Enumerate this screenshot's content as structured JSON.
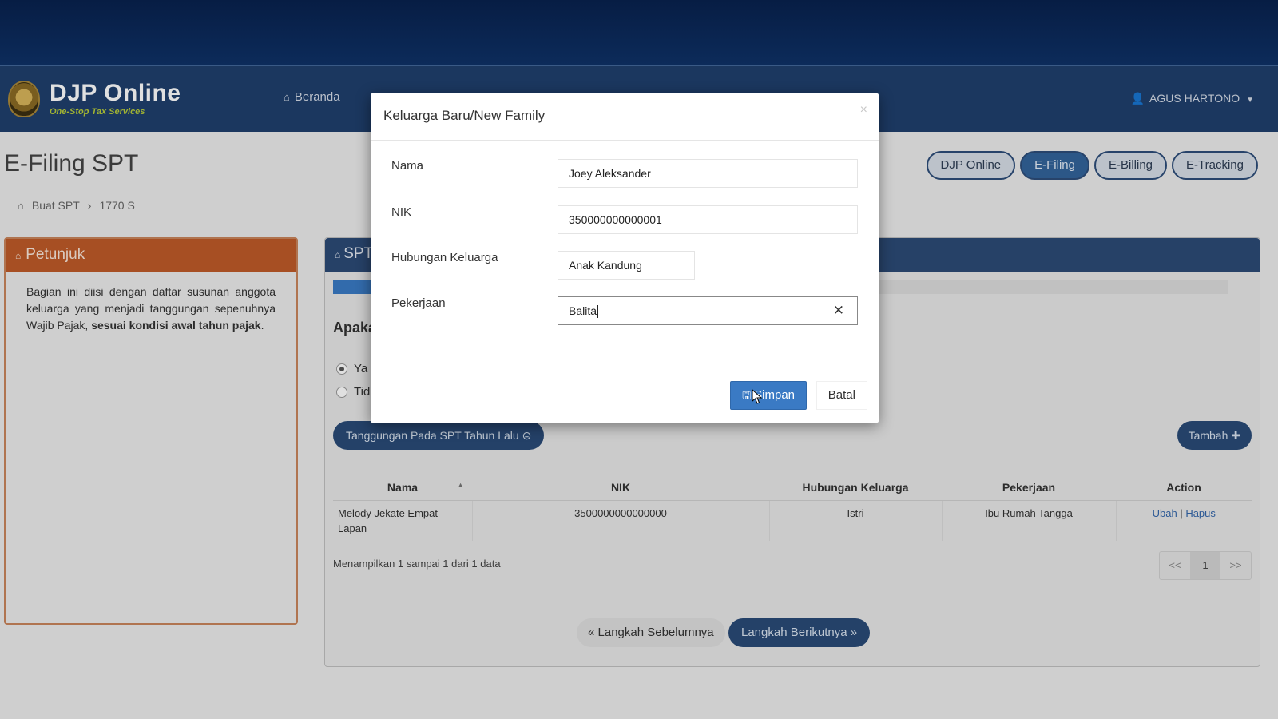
{
  "navbar": {
    "logo_title": "DJP Online",
    "logo_subtitle": "One-Stop Tax Services",
    "home_label": "Beranda",
    "user_label": "AGUS HARTONO"
  },
  "page": {
    "title": "E-Filing SPT",
    "breadcrumb": [
      "Buat SPT",
      "1770 S"
    ]
  },
  "service_tabs": [
    "DJP Online",
    "E-Filing",
    "E-Billing",
    "E-Tracking"
  ],
  "help_panel": {
    "title": "Petunjuk",
    "text_plain": "Bagian ini diisi dengan daftar susunan anggota keluarga yang menjadi tanggungan sepenuhnya Wajib Pajak, ",
    "text_bold": "sesuai kondisi awal tahun pajak",
    "text_end": "."
  },
  "main_panel": {
    "title": "SPT",
    "question": "Apaka",
    "radio_yes": "Ya",
    "radio_no": "Tid",
    "prev_tax_button": "Tanggungan Pada SPT Tahun Lalu",
    "add_button": "Tambah",
    "table": {
      "headers": [
        "Nama",
        "NIK",
        "Hubungan Keluarga",
        "Pekerjaan",
        "Action"
      ],
      "rows": [
        {
          "nama": "Melody Jekate Empat Lapan",
          "nik": "3500000000000000",
          "hubungan": "Istri",
          "pekerjaan": "Ibu Rumah Tangga",
          "action_edit": "Ubah",
          "action_sep": "|",
          "action_delete": "Hapus"
        }
      ]
    },
    "showing_text": "Menampilkan 1 sampai 1 dari 1 data",
    "pager": [
      "<<",
      "1",
      ">>"
    ],
    "prev_step": "Langkah Sebelumnya",
    "next_step": "Langkah Berikutnya"
  },
  "modal": {
    "title": "Keluarga Baru/New Family",
    "close": "×",
    "fields": {
      "nama_label": "Nama",
      "nama_value": "Joey Aleksander",
      "nik_label": "NIK",
      "nik_value": "350000000000001",
      "hubungan_label": "Hubungan Keluarga",
      "hubungan_value": "Anak Kandung",
      "pekerjaan_label": "Pekerjaan",
      "pekerjaan_value": "Balita",
      "clear": "✕"
    },
    "save_button": "Simpan",
    "cancel_button": "Batal"
  },
  "colors": {
    "navbar": "#1f3f6d",
    "help_header": "#bf5b28",
    "primary_button": "#3a7ac4"
  }
}
